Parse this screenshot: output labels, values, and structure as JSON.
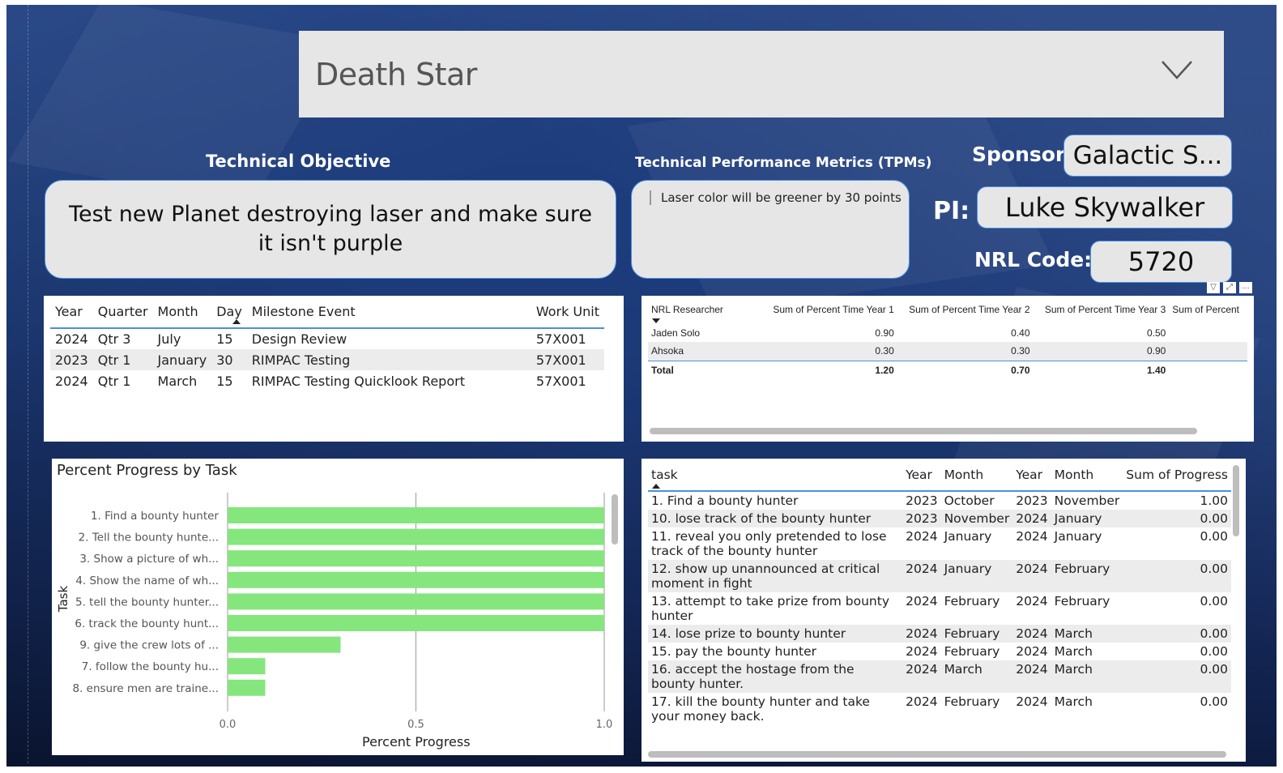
{
  "slicer": {
    "value": "Death Star"
  },
  "objective": {
    "header": "Technical Objective",
    "line1": "Test new Planet destroying laser and make sure",
    "line2": "it isn't purple"
  },
  "tpm": {
    "header": "Technical Performance Metrics  (TPMs)",
    "text": "Laser color will be greener by 30 points"
  },
  "sponsor": {
    "label": "Sponsor:",
    "value": "Galactic S..."
  },
  "pi": {
    "label": "PI:",
    "value": "Luke Skywalker"
  },
  "nrl": {
    "label": "NRL Code:",
    "value": "5720"
  },
  "milestones": {
    "columns": [
      "Year",
      "Quarter",
      "Month",
      "Day",
      "Milestone Event",
      "Work Unit"
    ],
    "rows": [
      [
        "2024",
        "Qtr 3",
        "July",
        "15",
        "Design Review",
        "57X001"
      ],
      [
        "2023",
        "Qtr 1",
        "January",
        "30",
        "RIMPAC Testing",
        "57X001"
      ],
      [
        "2024",
        "Qtr 1",
        "March",
        "15",
        "RIMPAC Testing Quicklook Report",
        "57X001"
      ]
    ]
  },
  "researchers": {
    "columns": [
      "NRL Researcher",
      "Sum of Percent Time Year 1",
      "Sum of Percent Time Year 2",
      "Sum of Percent Time Year 3",
      "Sum of Percent"
    ],
    "rows": [
      [
        "Jaden Solo",
        "0.90",
        "0.40",
        "0.50",
        ""
      ],
      [
        "Ahsoka",
        "0.30",
        "0.30",
        "0.90",
        ""
      ]
    ],
    "total": [
      "Total",
      "1.20",
      "0.70",
      "1.40",
      ""
    ]
  },
  "chart": {
    "title": "Percent Progress by Task",
    "xlabel": "Percent Progress",
    "ylabel": "Task",
    "ticks": [
      "0.0",
      "0.5",
      "1.0"
    ],
    "bar_color": "#85e67d"
  },
  "chart_data": {
    "type": "bar",
    "orientation": "horizontal",
    "categories": [
      "1. Find a bounty hunter",
      "2. Tell the bounty hunte...",
      "3. Show a picture of wh...",
      "4. Show the name of wh...",
      "5. tell the bounty hunter...",
      "6. track the bounty hunt...",
      "9. give the crew lots of ...",
      "7. follow the bounty hu...",
      "8. ensure men are traine..."
    ],
    "values": [
      1.0,
      1.0,
      1.0,
      1.0,
      1.0,
      1.0,
      0.3,
      0.1,
      0.1
    ],
    "xlim": [
      0,
      1
    ],
    "title": "Percent Progress by Task",
    "xlabel": "Percent Progress",
    "ylabel": "Task"
  },
  "tasks": {
    "columns": [
      "task",
      "Year",
      "Month",
      "Year",
      "Month",
      "Sum of Progress"
    ],
    "rows": [
      [
        "1. Find a bounty hunter",
        "2023",
        "October",
        "2023",
        "November",
        "1.00"
      ],
      [
        "10. lose track of the bounty hunter",
        "2023",
        "November",
        "2024",
        "January",
        "0.00"
      ],
      [
        "11. reveal you only pretended to lose track of the bounty hunter",
        "2024",
        "January",
        "2024",
        "January",
        "0.00"
      ],
      [
        "12. show up unannounced at critical moment in fight",
        "2024",
        "January",
        "2024",
        "February",
        "0.00"
      ],
      [
        "13. attempt to take prize from bounty hunter",
        "2024",
        "February",
        "2024",
        "February",
        "0.00"
      ],
      [
        "14. lose prize to bounty hunter",
        "2024",
        "February",
        "2024",
        "March",
        "0.00"
      ],
      [
        "15. pay the bounty hunter",
        "2024",
        "February",
        "2024",
        "March",
        "0.00"
      ],
      [
        "16. accept the hostage from the bounty hunter.",
        "2024",
        "March",
        "2024",
        "March",
        "0.00"
      ],
      [
        "17. kill the bounty hunter and take your money back.",
        "2024",
        "February",
        "2024",
        "March",
        "0.00"
      ]
    ]
  }
}
